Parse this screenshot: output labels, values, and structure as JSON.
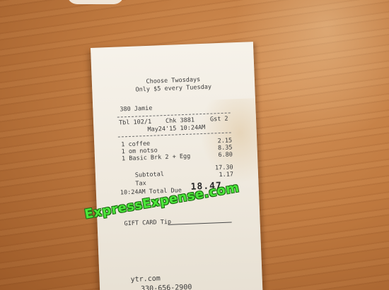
{
  "receipt": {
    "promo_line1": "Choose Twosdays",
    "promo_line2": "Only $5 every Tuesday",
    "server": "380 Jamie",
    "table": "Tbl 102/1",
    "check": "Chk 3881",
    "guests": "Gst 2",
    "datetime": "May24'15 10:24AM",
    "items": [
      {
        "name": "1 coffee",
        "price": "2.15"
      },
      {
        "name": "1 om notso",
        "price": "8.35"
      },
      {
        "name": "1 Basic Brk 2 + Egg",
        "price": "6.80"
      }
    ],
    "subtotal_label": "Subtotal",
    "subtotal_value": "17.30",
    "tax_label": "Tax",
    "tax_value": "1.17",
    "total_label": "10:24AM Total Due",
    "total_value": "18.47",
    "tip_label": "GIFT CARD Tip",
    "website": "ytr.com",
    "phone": "330-656-2900"
  },
  "watermark": {
    "text": "ExpressExpense.com",
    "color": "#4be63a"
  }
}
